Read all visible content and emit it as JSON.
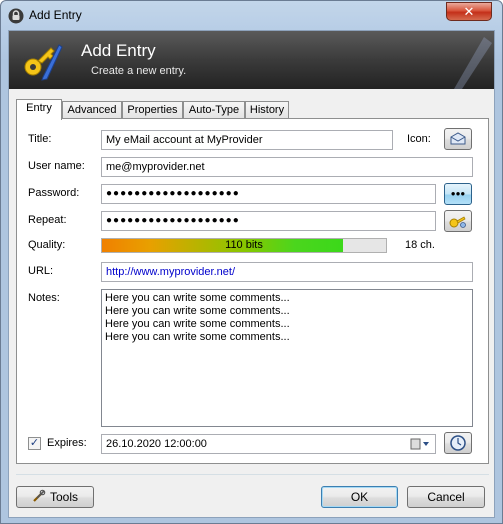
{
  "window": {
    "title": "Add Entry",
    "close_glyph": "✕"
  },
  "banner": {
    "title": "Add Entry",
    "subtitle": "Create a new entry."
  },
  "tabs": [
    {
      "label": "Entry",
      "active": true
    },
    {
      "label": "Advanced"
    },
    {
      "label": "Properties"
    },
    {
      "label": "Auto-Type"
    },
    {
      "label": "History"
    }
  ],
  "form": {
    "title_label": "Title:",
    "title_value": "My eMail account at MyProvider",
    "icon_label": "Icon:",
    "username_label": "User name:",
    "username_value": "me@myprovider.net",
    "password_label": "Password:",
    "password_value": "●●●●●●●●●●●●●●●●●●●",
    "password_toggle": "●●●",
    "repeat_label": "Repeat:",
    "repeat_value": "●●●●●●●●●●●●●●●●●●●",
    "quality_label": "Quality:",
    "quality_text": "110 bits",
    "quality_fraction": 0.85,
    "quality_chars": "18 ch.",
    "url_label": "URL:",
    "url_value": "http://www.myprovider.net/",
    "notes_label": "Notes:",
    "notes_lines": [
      "Here you can write some comments...",
      "Here you can write some comments...",
      "Here you can write some comments...",
      "Here you can write some comments..."
    ],
    "expires_checked": true,
    "expires_label": "Expires:",
    "expires_value": "26.10.2020 12:00:00"
  },
  "buttons": {
    "tools": "Tools",
    "ok": "OK",
    "cancel": "Cancel"
  },
  "colors": {
    "url": "#0000cc",
    "banner": "#3b3b3b",
    "quality_start": "#f08000",
    "quality_end": "#3bd81a"
  }
}
